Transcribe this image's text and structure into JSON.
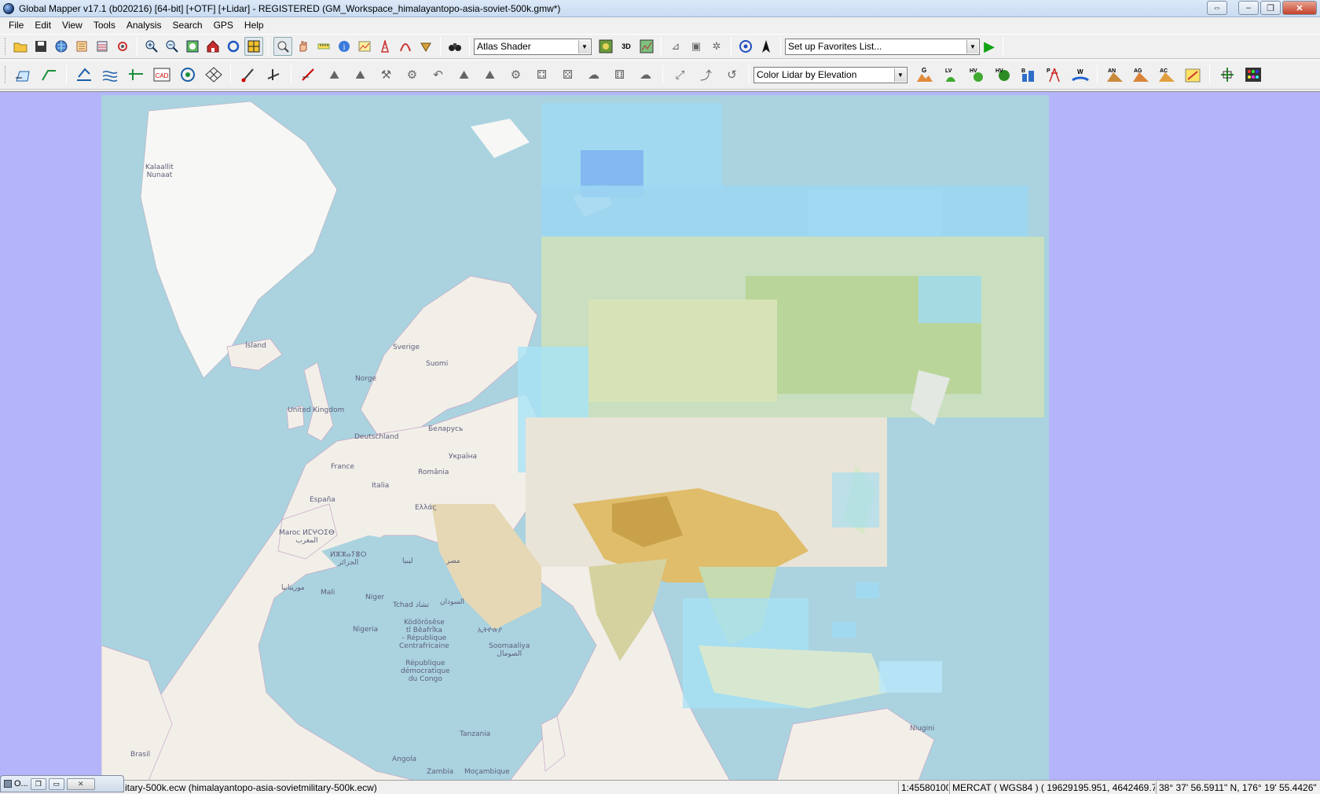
{
  "window": {
    "title": "Global Mapper v17.1 (b020216) [64-bit] [+OTF] [+Lidar] - REGISTERED (GM_Workspace_himalayantopo-asia-soviet-500k.gmw*)",
    "buttons": {
      "extra": "⇔",
      "minimize": "‒",
      "maximize": "❐",
      "close": "✕"
    }
  },
  "menu": [
    "File",
    "Edit",
    "View",
    "Tools",
    "Analysis",
    "Search",
    "GPS",
    "Help"
  ],
  "toolbar1": {
    "shader_select": "Atlas Shader",
    "favorites_select": "Set up Favorites List...",
    "icons": [
      "open-folder",
      "save",
      "globe",
      "overlay-control",
      "layers",
      "config",
      "zoom-in",
      "zoom-out",
      "full-view",
      "home",
      "refresh",
      "grid-view",
      "pointer",
      "pan",
      "measure",
      "info",
      "digitizer",
      "path-profile",
      "view-shed",
      "3d-path",
      "binoculars"
    ]
  },
  "toolbar2": {
    "lidar_select": "Color Lidar by Elevation",
    "lidar_buttons": [
      "G",
      "LV",
      "HV",
      "HV",
      "B",
      "P",
      "W",
      "AN",
      "AG",
      "AC"
    ]
  },
  "map_labels": {
    "greenland": "Kalaallit\nNunaat",
    "iceland": "Ísland",
    "sweden": "Sverige",
    "finland": "Suomi",
    "norway": "Norge",
    "uk": "United Kingdom",
    "germany": "Deutschland",
    "belarus": "Беларусь",
    "ukraine": "Україна",
    "france": "France",
    "romania": "România",
    "italy": "Italia",
    "spain": "España",
    "greece": "Ελλάς",
    "morocco": "Maroc ⵍⵎⵖⵔⵉⴱ\nالمغرب",
    "algeria": "ⵍⵣⵣⴰⵢⴻⵔ\nالجزائر",
    "libya": "ليبيا",
    "egypt": "مصر",
    "mauritania": "موريتانيا",
    "mali": "Mali",
    "niger": "Niger",
    "chad": "Tchad تشاد",
    "sudan": "السودان",
    "nigeria": "Nigeria",
    "car": "Ködörösêse\ntî Bêafrîka\n- République\nCentrafricaine",
    "ethiopia": "ኢትዮጵያ",
    "drc": "République\ndémocratique\ndu Congo",
    "somalia": "Soomaaliya\nالصومال",
    "tanzania": "Tanzania",
    "brazil": "Brasil",
    "angola": "Angola",
    "zambia": "Zambia",
    "mozambique": "Moçambique",
    "png": "Niugini"
  },
  "status": {
    "file": "itary-500k.ecw (himalayantopo-asia-sovietmilitary-500k.ecw)",
    "scale": "1:45580100",
    "projection": "MERCAT ( WGS84 ) ( 19629195.951, 4642469.757 )",
    "coords": "38° 37' 56.5911\" N, 176° 19' 55.4426\" E"
  },
  "mini_window": {
    "label": "O..."
  },
  "colors": {
    "background": "#b4b4fb",
    "ocean": "#aad3df",
    "land": "#f2efe9",
    "imagery_blue": "#9fdcf4"
  }
}
